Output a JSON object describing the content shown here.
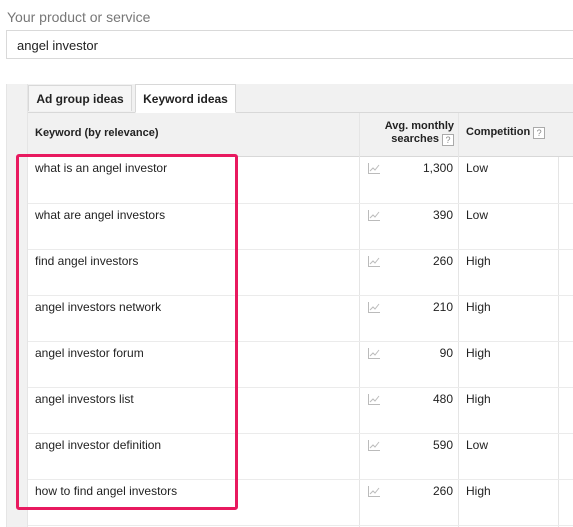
{
  "search": {
    "label": "Your product or service",
    "value": "angel investor"
  },
  "tabs": [
    {
      "label": "Ad group ideas"
    },
    {
      "label": "Keyword ideas"
    }
  ],
  "table": {
    "headers": {
      "keyword": "Keyword (by relevance)",
      "searches_line1": "Avg. monthly",
      "searches_line2": "searches",
      "competition": "Competition",
      "help": "?"
    },
    "rows": [
      {
        "keyword": "what is an angel investor",
        "searches": "1,300",
        "competition": "Low"
      },
      {
        "keyword": "what are angel investors",
        "searches": "390",
        "competition": "Low"
      },
      {
        "keyword": "find angel investors",
        "searches": "260",
        "competition": "High"
      },
      {
        "keyword": "angel investors network",
        "searches": "210",
        "competition": "High"
      },
      {
        "keyword": "angel investor forum",
        "searches": "90",
        "competition": "High"
      },
      {
        "keyword": "angel investors list",
        "searches": "480",
        "competition": "High"
      },
      {
        "keyword": "angel investor definition",
        "searches": "590",
        "competition": "Low"
      },
      {
        "keyword": "how to find angel investors",
        "searches": "260",
        "competition": "High"
      }
    ]
  },
  "colors": {
    "highlight": "#e8195f",
    "header_bg": "#f1f1f1"
  },
  "icons": {
    "trend": "trend-chart-icon",
    "help": "help-icon"
  }
}
